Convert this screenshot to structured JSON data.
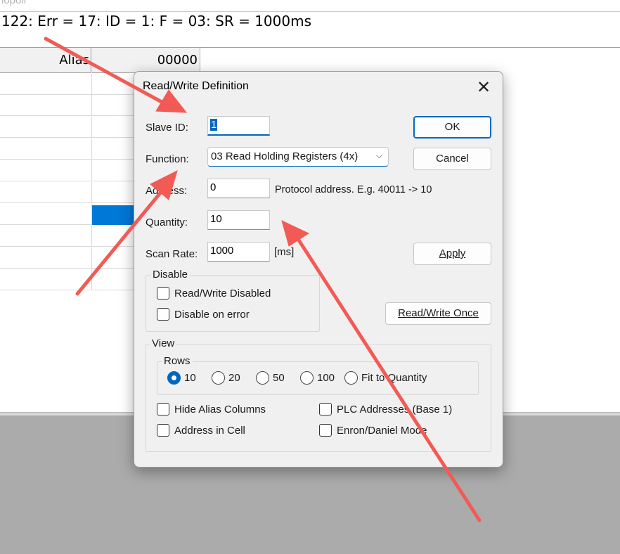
{
  "background": {
    "top_title": "lopoll",
    "status_line": "122: Err = 17: ID = 1: F = 03: SR = 1000ms",
    "grid_header": {
      "alias": "Alias",
      "col0": "00000"
    }
  },
  "dialog": {
    "title": "Read/Write Definition",
    "close_icon": "close-icon",
    "slave_id_label": "Slave ID:",
    "slave_id_value": "1",
    "function_label": "Function:",
    "function_value": "03 Read Holding Registers (4x)",
    "address_label": "Address:",
    "address_value": "0",
    "address_hint": "Protocol address. E.g. 40011 -> 10",
    "quantity_label": "Quantity:",
    "quantity_value": "10",
    "scan_rate_label": "Scan Rate:",
    "scan_rate_value": "1000",
    "scan_rate_unit": "[ms]",
    "ok_label": "OK",
    "cancel_label": "Cancel",
    "apply_label": "Apply",
    "rw_once_label": "Read/Write Once",
    "disable_group": {
      "title": "Disable",
      "rw_disabled_label": "Read/Write Disabled",
      "disable_on_error_label": "Disable on error"
    },
    "view_group": {
      "title": "View",
      "rows_title": "Rows",
      "rows_options": [
        "10",
        "20",
        "50",
        "100",
        "Fit to Quantity"
      ],
      "rows_selected": "10",
      "hide_alias_label": "Hide Alias Columns",
      "address_in_cell_label": "Address in Cell",
      "plc_addresses_label": "PLC Addresses (Base 1)",
      "enron_label": "Enron/Daniel Mode"
    }
  },
  "annotation_color": "#f25b55"
}
